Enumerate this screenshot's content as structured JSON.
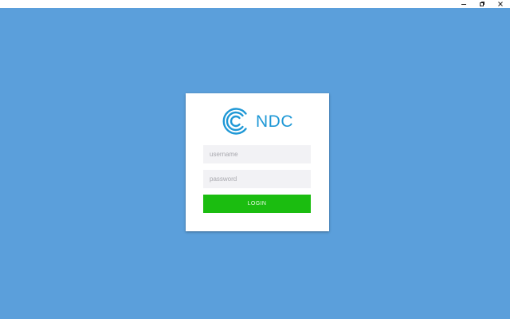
{
  "window": {
    "controls": [
      {
        "name": "minimize",
        "icon": "minimize-icon"
      },
      {
        "name": "restore",
        "icon": "restore-icon"
      },
      {
        "name": "close",
        "icon": "close-icon"
      }
    ]
  },
  "colors": {
    "background": "#5b9fdb",
    "brand": "#1f98d6",
    "login_button": "#1bbd10",
    "input_background": "#f2f2f5"
  },
  "login": {
    "brand_name": "NDC",
    "brand_icon": "ndc-logo-icon",
    "username_placeholder": "username",
    "username_value": "",
    "password_placeholder": "password",
    "password_value": "",
    "submit_label": "LOGIN"
  }
}
